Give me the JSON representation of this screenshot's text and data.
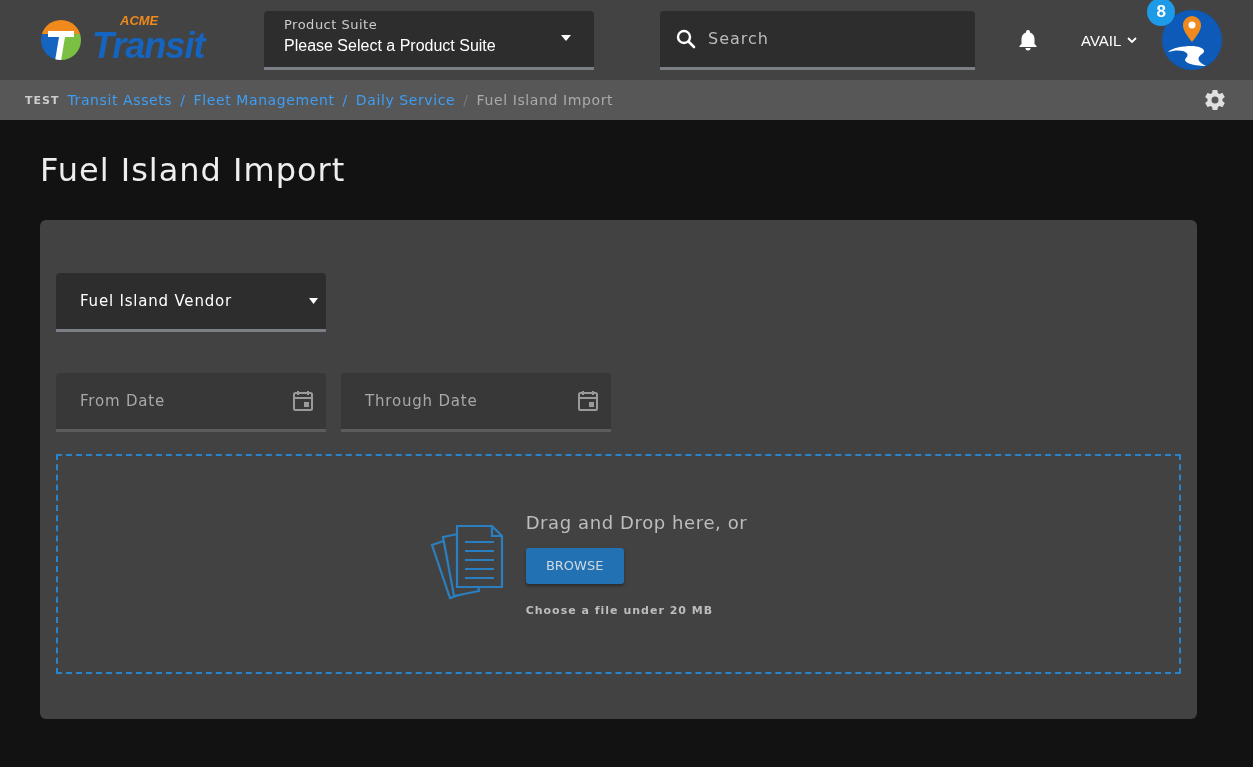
{
  "header": {
    "logo": {
      "top": "ACME",
      "main": "Transit"
    },
    "product_suite": {
      "label": "Product Suite",
      "value": "Please Select a Product Suite"
    },
    "search": {
      "placeholder": "Search"
    },
    "user_menu": {
      "label": "AVAIL"
    },
    "notification_count": "8"
  },
  "breadcrumb": {
    "environment": "TEST",
    "items": [
      {
        "label": "Transit Assets",
        "kind": "link"
      },
      {
        "label": "Fleet Management",
        "kind": "link"
      },
      {
        "label": "Daily Service",
        "kind": "link"
      },
      {
        "label": "Fuel Island Import",
        "kind": "current"
      }
    ],
    "separator": "/"
  },
  "page_title": "Fuel Island Import",
  "form": {
    "vendor_select": {
      "label": "Fuel Island Vendor"
    },
    "date_fields": [
      {
        "placeholder": "From Date"
      },
      {
        "placeholder": "Through Date"
      }
    ],
    "dropzone": {
      "prompt": "Drag and Drop here, or",
      "button": "BROWSE",
      "hint": "Choose a file under 20 MB"
    }
  }
}
